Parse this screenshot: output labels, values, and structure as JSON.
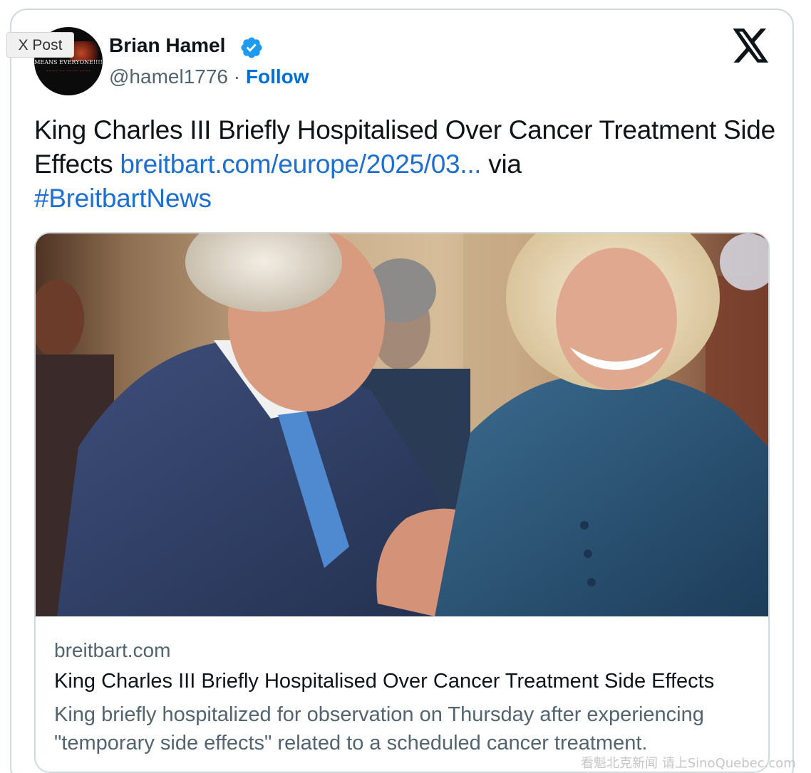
{
  "overlay_label": "X Post",
  "author": {
    "avatar_text": "MEANS EVERYONE!!!!",
    "name": "Brian Hamel",
    "handle": "@hamel1776",
    "separator": "·",
    "follow_label": "Follow",
    "verified_color": "#1d9bf0"
  },
  "post": {
    "text_before": "King Charles III Briefly Hospitalised Over Cancer Treatment Side Effects ",
    "link_text": "breitbart.com/europe/2025/03...",
    "text_middle": " via ",
    "hashtag": "#BreitbartNews",
    "link_color": "#1d6fd1"
  },
  "link_card": {
    "domain": "breitbart.com",
    "title": "King Charles III Briefly Hospitalised Over Cancer Treatment Side Effects",
    "description": "King briefly hospitalized for observation on Thursday after experiencing \"temporary side effects\" related to a scheduled cancer treatment."
  },
  "watermark": "看魁北克新闻 请上SinoQuebec.com",
  "icons": {
    "brand": "x-logo-icon",
    "verified": "verified-badge-icon"
  }
}
